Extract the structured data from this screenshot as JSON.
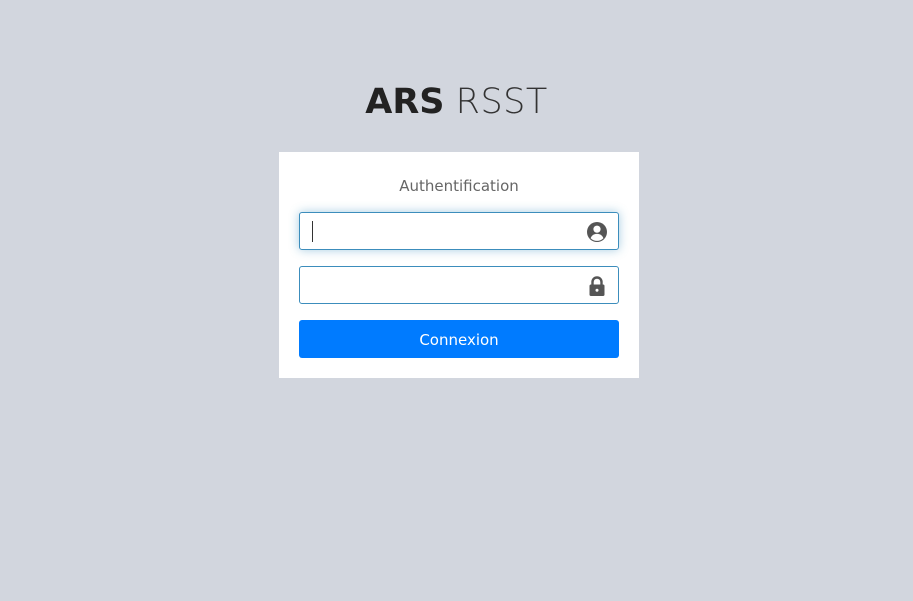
{
  "brand": {
    "bold": "ARS",
    "light": "RSST"
  },
  "login": {
    "title": "Authentification",
    "username": {
      "value": "",
      "placeholder": "",
      "icon": "user-circle-icon"
    },
    "password": {
      "value": "",
      "placeholder": "",
      "icon": "lock-icon"
    },
    "submit_label": "Connexion"
  },
  "colors": {
    "background": "#d2d6de",
    "card": "#ffffff",
    "accent": "#007bff",
    "input_border": "#3c8dbc",
    "icon": "#555555"
  }
}
